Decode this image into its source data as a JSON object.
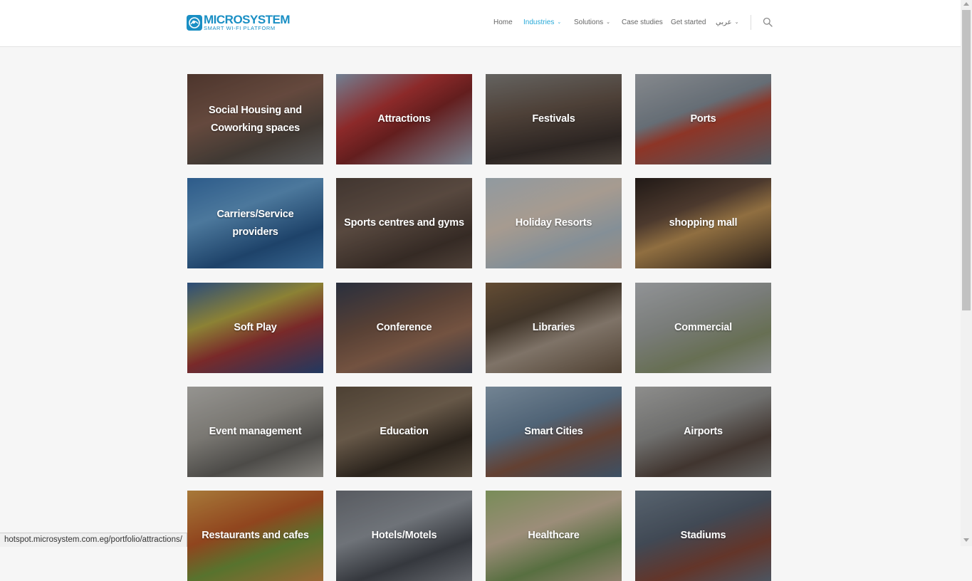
{
  "brand": {
    "name": "MICROSYSTEM",
    "tagline": "SMART WI-FI PLATFORM",
    "color": "#1a8fc4"
  },
  "nav": {
    "items": [
      {
        "label": "Home",
        "active": false,
        "dropdown": false
      },
      {
        "label": "Industries",
        "active": true,
        "dropdown": true
      },
      {
        "label": "Solutions",
        "active": false,
        "dropdown": true
      },
      {
        "label": "Case studies",
        "active": false,
        "dropdown": false
      },
      {
        "label": "Get started",
        "active": false,
        "dropdown": false
      },
      {
        "label": "عربي",
        "active": false,
        "dropdown": true
      }
    ],
    "search_icon": "search-icon",
    "active_color": "#27a9d8"
  },
  "industries": [
    {
      "label": "Social Housing and Coworking spaces"
    },
    {
      "label": "Attractions"
    },
    {
      "label": "Festivals"
    },
    {
      "label": "Ports"
    },
    {
      "label": "Carriers/Service providers"
    },
    {
      "label": "Sports centres and gyms"
    },
    {
      "label": "Holiday Resorts"
    },
    {
      "label": "shopping mall"
    },
    {
      "label": "Soft Play"
    },
    {
      "label": "Conference"
    },
    {
      "label": "Libraries"
    },
    {
      "label": "Commercial"
    },
    {
      "label": "Event management"
    },
    {
      "label": "Education"
    },
    {
      "label": "Smart Cities"
    },
    {
      "label": "Airports"
    },
    {
      "label": "Restaurants and cafes"
    },
    {
      "label": "Hotels/Motels"
    },
    {
      "label": "Healthcare"
    },
    {
      "label": "Stadiums"
    }
  ],
  "status_bar": {
    "url": "hotspot.microsystem.com.eg/portfolio/attractions/"
  }
}
